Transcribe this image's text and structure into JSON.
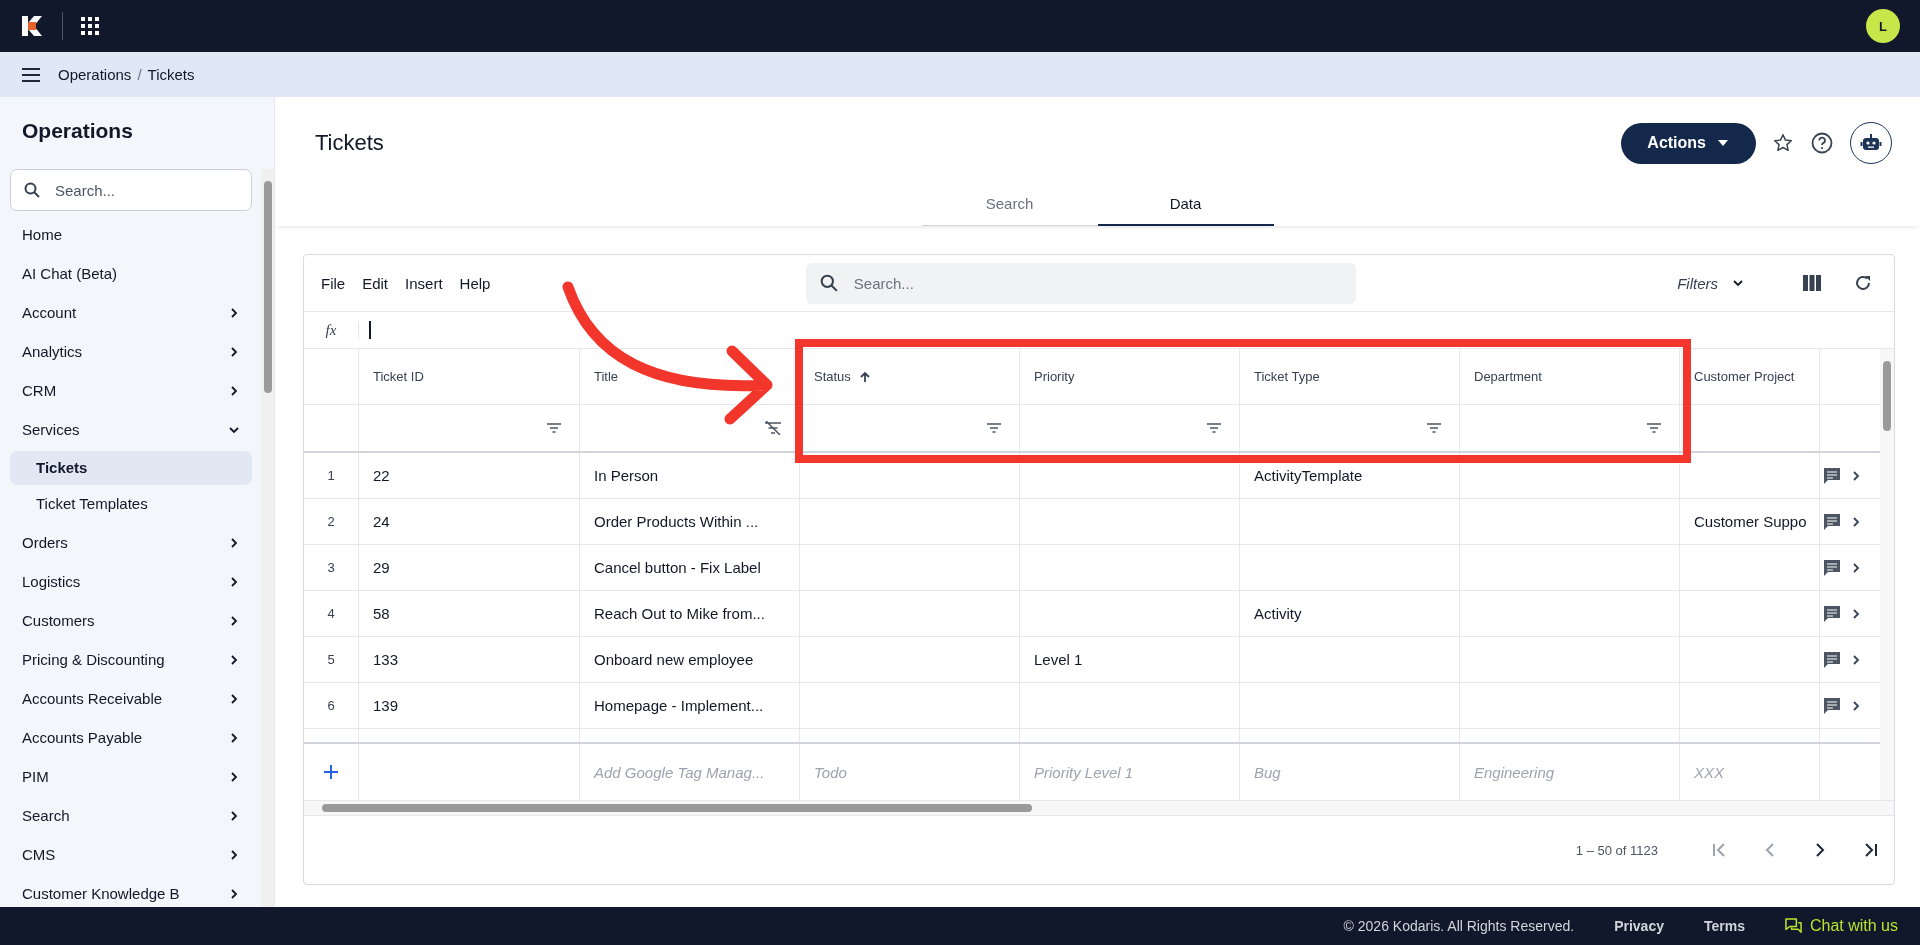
{
  "topbar": {
    "avatar": "L"
  },
  "breadcrumb": {
    "items": [
      "Operations",
      "Tickets"
    ],
    "separator": "/"
  },
  "sidebar": {
    "title": "Operations",
    "search": {
      "placeholder": "Search..."
    },
    "items": [
      {
        "label": "Home",
        "expandable": false
      },
      {
        "label": "AI Chat (Beta)",
        "expandable": false
      },
      {
        "label": "Account",
        "expandable": true,
        "expanded": false
      },
      {
        "label": "Analytics",
        "expandable": true,
        "expanded": false
      },
      {
        "label": "CRM",
        "expandable": true,
        "expanded": false
      },
      {
        "label": "Services",
        "expandable": true,
        "expanded": true,
        "children": [
          {
            "label": "Tickets",
            "selected": true
          },
          {
            "label": "Ticket Templates",
            "selected": false
          }
        ]
      },
      {
        "label": "Orders",
        "expandable": true,
        "expanded": false
      },
      {
        "label": "Logistics",
        "expandable": true,
        "expanded": false
      },
      {
        "label": "Customers",
        "expandable": true,
        "expanded": false
      },
      {
        "label": "Pricing & Discounting",
        "expandable": true,
        "expanded": false
      },
      {
        "label": "Accounts Receivable",
        "expandable": true,
        "expanded": false
      },
      {
        "label": "Accounts Payable",
        "expandable": true,
        "expanded": false
      },
      {
        "label": "PIM",
        "expandable": true,
        "expanded": false
      },
      {
        "label": "Search",
        "expandable": true,
        "expanded": false
      },
      {
        "label": "CMS",
        "expandable": true,
        "expanded": false
      },
      {
        "label": "Customer Knowledge B",
        "expandable": true,
        "expanded": false
      }
    ]
  },
  "page": {
    "title": "Tickets",
    "actions": "Actions"
  },
  "tabs": [
    {
      "label": "Search",
      "selected": false
    },
    {
      "label": "Data",
      "selected": true
    }
  ],
  "grid": {
    "menu": [
      "File",
      "Edit",
      "Insert",
      "Help"
    ],
    "search": {
      "placeholder": "Search..."
    },
    "filters": "Filters",
    "formula_label": "fx",
    "columns": [
      {
        "label": "Ticket ID",
        "filterable": true,
        "filter_active": false,
        "sorted_ascending": false
      },
      {
        "label": "Title",
        "filterable": true,
        "filter_active": true,
        "sorted_ascending": false
      },
      {
        "label": "Status",
        "filterable": true,
        "filter_active": false,
        "sorted_ascending": true
      },
      {
        "label": "Priority",
        "filterable": true,
        "filter_active": false,
        "sorted_ascending": false
      },
      {
        "label": "Ticket Type",
        "filterable": true,
        "filter_active": false,
        "sorted_ascending": false
      },
      {
        "label": "Department",
        "filterable": true,
        "filter_active": false,
        "sorted_ascending": false
      },
      {
        "label": "Customer Project"
      }
    ],
    "rows": [
      {
        "num": "1",
        "cells": [
          "22",
          "In Person",
          "",
          "",
          "ActivityTemplate",
          "",
          ""
        ]
      },
      {
        "num": "2",
        "cells": [
          "24",
          "Order Products Within ...",
          "",
          "",
          "",
          "",
          "Customer Suppo"
        ]
      },
      {
        "num": "3",
        "cells": [
          "29",
          "Cancel button - Fix Label",
          "",
          "",
          "",
          "",
          ""
        ]
      },
      {
        "num": "4",
        "cells": [
          "58",
          "Reach Out to Mike from...",
          "",
          "",
          "Activity",
          "",
          ""
        ]
      },
      {
        "num": "5",
        "cells": [
          "133",
          "Onboard new employee",
          "",
          "Level 1",
          "",
          "",
          ""
        ]
      },
      {
        "num": "6",
        "cells": [
          "139",
          "Homepage - Implement...",
          "",
          "",
          "",
          "",
          ""
        ]
      }
    ],
    "new_row": [
      "Add Google Tag Manag...",
      "Todo",
      "Priority Level 1",
      "Bug",
      "Engineering",
      "XXX"
    ],
    "pager": "1 – 50 of 1123"
  },
  "footer": {
    "copyright": "© 2026 Kodaris. All Rights Reserved.",
    "links": [
      "Privacy",
      "Terms"
    ],
    "chat": "Chat with us"
  }
}
